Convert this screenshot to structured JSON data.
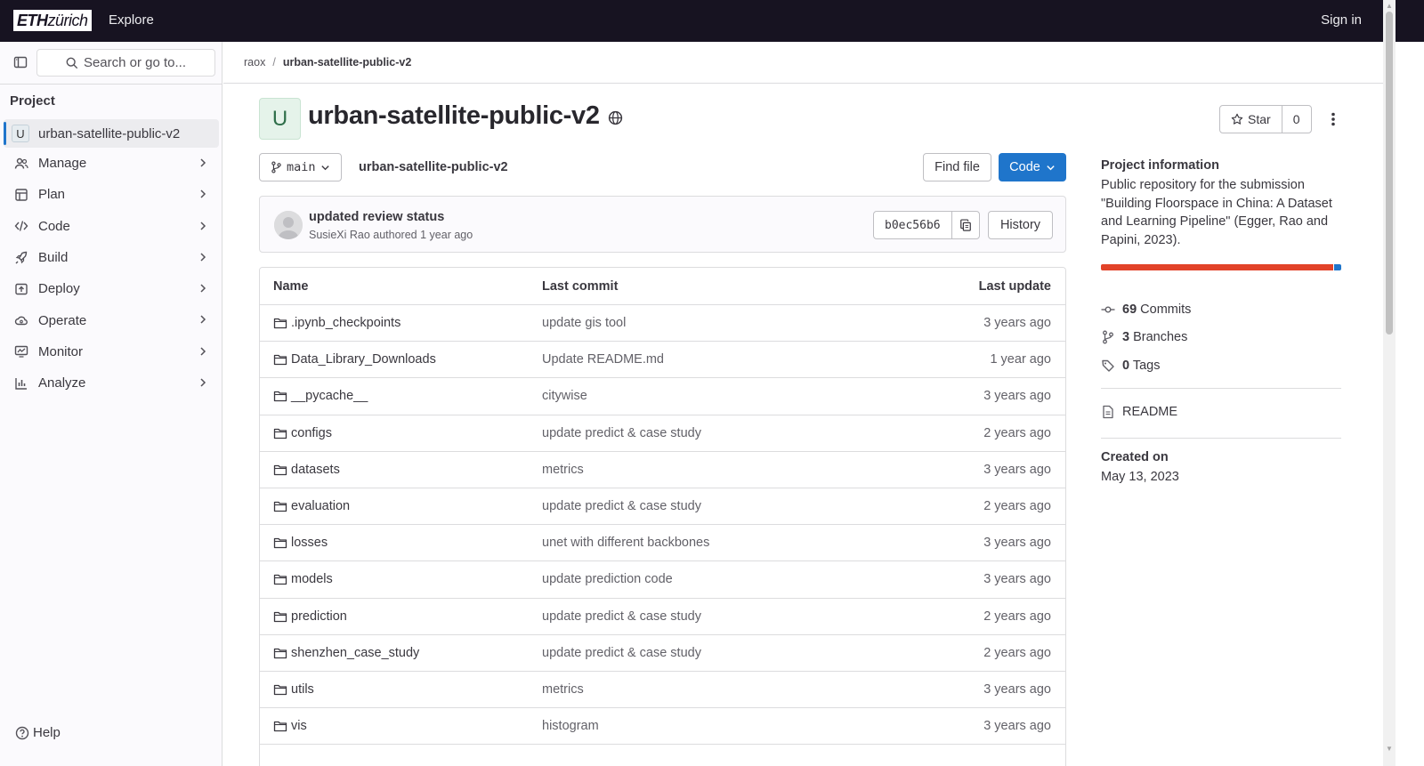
{
  "topbar": {
    "logo_eth": "ETH",
    "logo_zurich": "zürich",
    "explore": "Explore",
    "signin": "Sign in"
  },
  "sidebar": {
    "search_placeholder": "Search or go to...",
    "heading": "Project",
    "project": {
      "avatar_letter": "U",
      "name": "urban-satellite-public-v2"
    },
    "items": [
      {
        "label": "Manage",
        "icon": "users-icon"
      },
      {
        "label": "Plan",
        "icon": "plan-icon"
      },
      {
        "label": "Code",
        "icon": "code-icon"
      },
      {
        "label": "Build",
        "icon": "rocket-icon"
      },
      {
        "label": "Deploy",
        "icon": "deploy-icon"
      },
      {
        "label": "Operate",
        "icon": "cloud-icon"
      },
      {
        "label": "Monitor",
        "icon": "monitor-icon"
      },
      {
        "label": "Analyze",
        "icon": "chart-icon"
      }
    ],
    "help": "Help"
  },
  "breadcrumb": {
    "owner": "raox",
    "separator": "/",
    "project": "urban-satellite-public-v2"
  },
  "repo": {
    "avatar_letter": "U",
    "title": "urban-satellite-public-v2",
    "star_label": "Star",
    "star_count": "0",
    "branch": "main",
    "path_name": "urban-satellite-public-v2",
    "find_file": "Find file",
    "code_label": "Code"
  },
  "commit": {
    "title": "updated review status",
    "author": "SusieXi Rao",
    "authored_text": "authored",
    "time": "1 year ago",
    "sha": "b0ec56b6",
    "history_label": "History"
  },
  "tree": {
    "headers": {
      "name": "Name",
      "last_commit": "Last commit",
      "last_update": "Last update"
    },
    "rows": [
      {
        "name": ".ipynb_checkpoints",
        "commit": "update gis tool",
        "updated": "3 years ago"
      },
      {
        "name": "Data_Library_Downloads",
        "commit": "Update README.md",
        "updated": "1 year ago"
      },
      {
        "name": "__pycache__",
        "commit": "citywise",
        "updated": "3 years ago"
      },
      {
        "name": "configs",
        "commit": "update predict & case study",
        "updated": "2 years ago"
      },
      {
        "name": "datasets",
        "commit": "metrics",
        "updated": "3 years ago"
      },
      {
        "name": "evaluation",
        "commit": "update predict & case study",
        "updated": "2 years ago"
      },
      {
        "name": "losses",
        "commit": "unet with different backbones",
        "updated": "3 years ago"
      },
      {
        "name": "models",
        "commit": "update prediction code",
        "updated": "3 years ago"
      },
      {
        "name": "prediction",
        "commit": "update predict & case study",
        "updated": "2 years ago"
      },
      {
        "name": "shenzhen_case_study",
        "commit": "update predict & case study",
        "updated": "2 years ago"
      },
      {
        "name": "utils",
        "commit": "metrics",
        "updated": "3 years ago"
      },
      {
        "name": "vis",
        "commit": "histogram",
        "updated": "3 years ago"
      }
    ]
  },
  "info": {
    "title": "Project information",
    "description": "Public repository for the submission \"Building Floorspace in China: A Dataset and Learning Pipeline\" (Egger, Rao and Papini, 2023).",
    "languages": [
      {
        "color": "#e24329",
        "share": 0.965
      },
      {
        "color": "#ffffff",
        "share": 0.005
      },
      {
        "color": "#1f75cb",
        "share": 0.03
      }
    ],
    "commits_count": "69",
    "commits_label": "Commits",
    "branches_count": "3",
    "branches_label": "Branches",
    "tags_count": "0",
    "tags_label": "Tags",
    "readme": "README",
    "created_label": "Created on",
    "created_date": "May 13, 2023"
  }
}
